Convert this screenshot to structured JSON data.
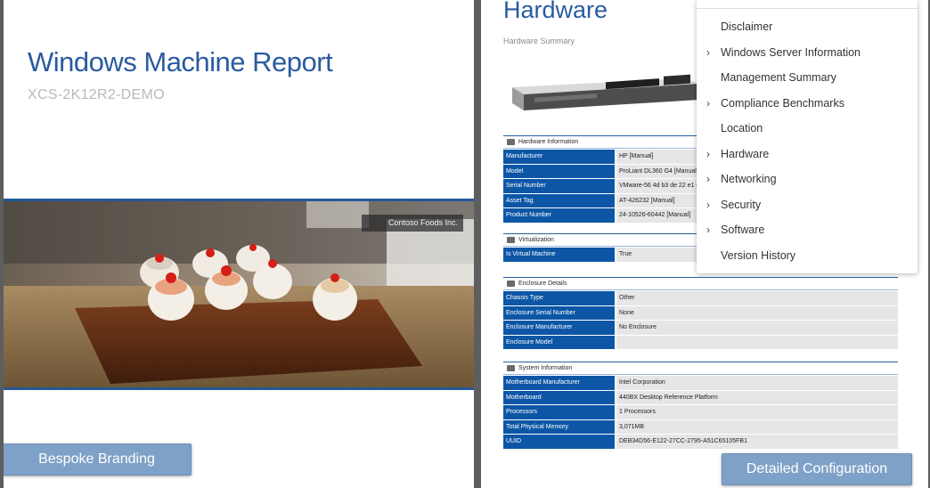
{
  "cover": {
    "title": "Windows Machine Report",
    "machine": "XCS-2K12R2-DEMO",
    "company": "Contoso Foods Inc.",
    "branding_button": "Bespoke Branding"
  },
  "hardware": {
    "title": "Hardware",
    "subtitle": "Hardware Summary",
    "config_button": "Detailed Configuration",
    "groups": [
      {
        "label": "Hardware Information",
        "icon": "server-icon",
        "rows": [
          {
            "k": "Manufacturer",
            "v": "HP [Manual]"
          },
          {
            "k": "Model",
            "v": "ProLiant DL360 G4 [Manual]"
          },
          {
            "k": "Serial Number",
            "v": "VMware-56 4d b3 de 22 e1 c"
          },
          {
            "k": "Asset Tag",
            "v": "AT-426232 [Manual]"
          },
          {
            "k": "Product Number",
            "v": "24-10526-60442 [Manual]"
          }
        ]
      },
      {
        "label": "Virtualization",
        "icon": "virtualization-icon",
        "rows": [
          {
            "k": "Is Virtual Machine",
            "v": "True"
          }
        ]
      },
      {
        "label": "Enclosure Details",
        "icon": "enclosure-icon",
        "rows": [
          {
            "k": "Chassis Type",
            "v": "Other"
          },
          {
            "k": "Enclosure Serial Number",
            "v": "None"
          },
          {
            "k": "Enclosure Manufacturer",
            "v": "No Enclosure"
          },
          {
            "k": "Enclosure Model",
            "v": ""
          }
        ]
      },
      {
        "label": "System Information",
        "icon": "system-icon",
        "rows": [
          {
            "k": "Motherboard Manufacturer",
            "v": "Intel Corporation"
          },
          {
            "k": "Motherboard",
            "v": "440BX Desktop Reference Platform"
          },
          {
            "k": "Processors",
            "v": "1 Processors"
          },
          {
            "k": "Total Physical Memory",
            "v": "3,071MB"
          },
          {
            "k": "UUID",
            "v": "DEB34D56-E122-27CC-2795-A51C65105FB1"
          }
        ]
      }
    ]
  },
  "toc": {
    "items": [
      {
        "label": "Disclaimer",
        "expandable": false
      },
      {
        "label": "Windows Server Information",
        "expandable": true
      },
      {
        "label": "Management Summary",
        "expandable": false
      },
      {
        "label": "Compliance Benchmarks",
        "expandable": true
      },
      {
        "label": "Location",
        "expandable": false
      },
      {
        "label": "Hardware",
        "expandable": true
      },
      {
        "label": "Networking",
        "expandable": true
      },
      {
        "label": "Security",
        "expandable": true
      },
      {
        "label": "Software",
        "expandable": true
      },
      {
        "label": "Version History",
        "expandable": false
      }
    ]
  },
  "colors": {
    "accent": "#2a5ba0",
    "label_cell": "#0d56a6",
    "value_cell": "#e6e6e6",
    "button": "#7ea1c7"
  }
}
